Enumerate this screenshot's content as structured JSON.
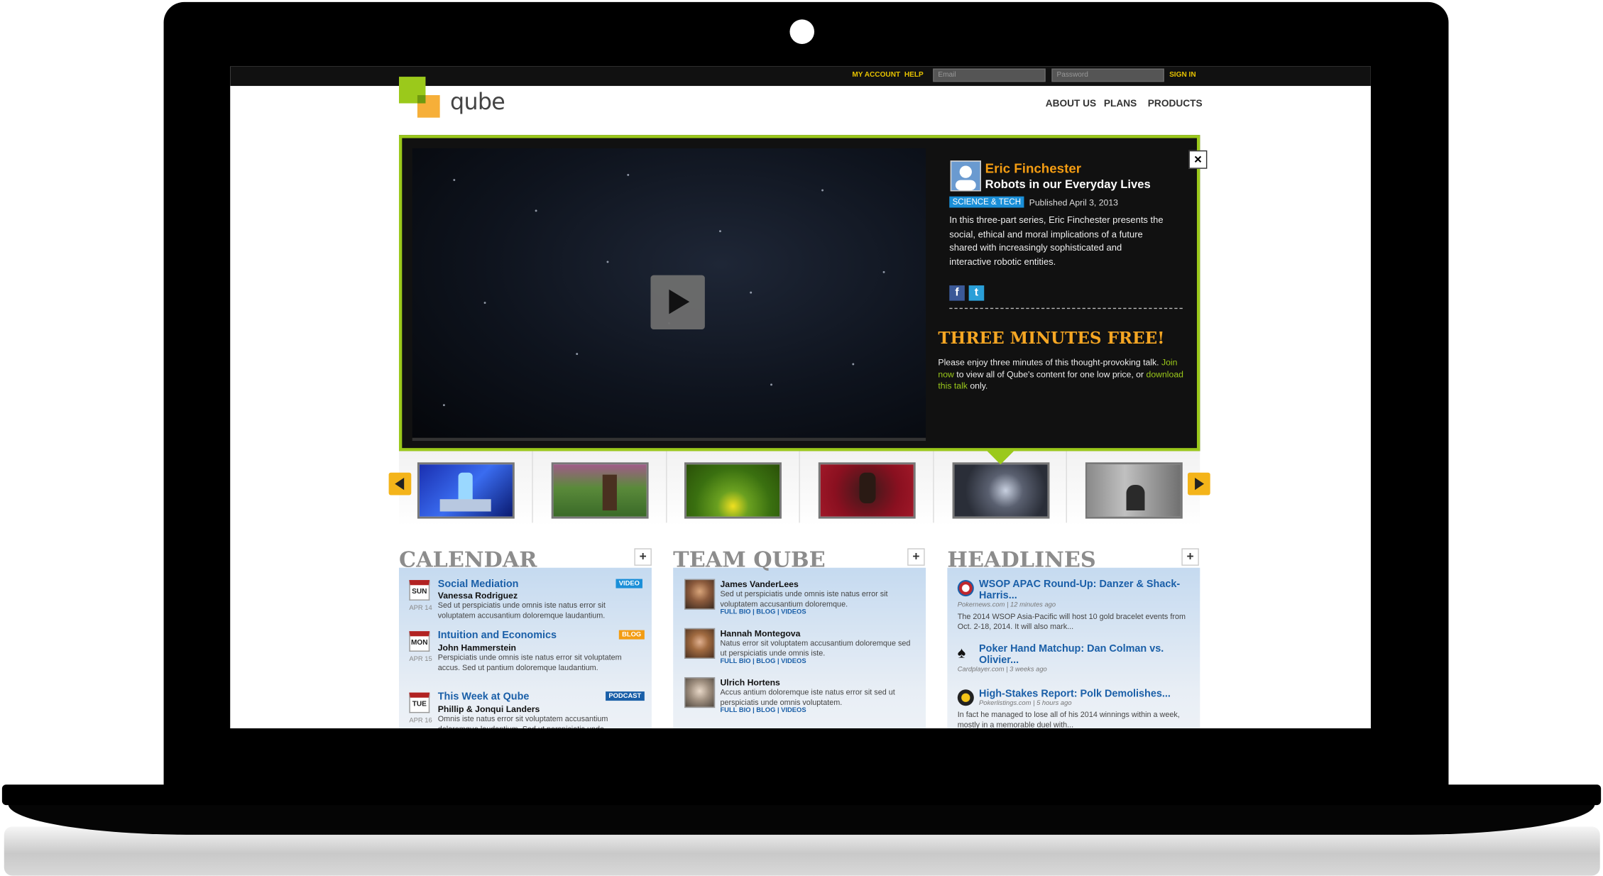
{
  "topbar": {
    "my_account": "MY ACCOUNT",
    "help": "HELP",
    "email_placeholder": "Email",
    "password_placeholder": "Password",
    "sign_in": "SIGN IN"
  },
  "brand": {
    "logo_text": "qube",
    "accent": "#9bc91b",
    "orange": "#f5a623"
  },
  "nav": [
    "ABOUT US",
    "PLANS",
    "PRODUCTS"
  ],
  "hero": {
    "close_label": "×",
    "author": "Eric Finchester",
    "title": "Robots in our Everyday Lives",
    "category": "SCIENCE & TECH",
    "published": "Published April 3, 2013",
    "description": "In this three-part series, Eric Finchester presents the social, ethical and moral implications of a future shared with increasingly sophisticated and interactive robotic entities.",
    "facebook": "f",
    "twitter": "t",
    "promo_title": "THREE MINUTES FREE!",
    "promo_1": "Please enjoy three minutes of this thought-provoking talk.",
    "promo_link_1": "Join now",
    "promo_2": "to view all of Qube's content for one low price, or",
    "promo_link_2": "download this talk",
    "promo_3": "only."
  },
  "calendar": {
    "heading": "CALENDAR",
    "items": [
      {
        "day": "SUN",
        "date": "APR 14",
        "title": "Social Mediation",
        "speaker": "Vanessa Rodriguez",
        "tag": "VIDEO",
        "tag_color": "#1a8fd8",
        "body": "Sed ut perspiciatis unde omnis iste natus error sit voluptatem accusantium doloremque laudantium."
      },
      {
        "day": "MON",
        "date": "APR 15",
        "title": "Intuition and Economics",
        "speaker": "John Hammerstein",
        "tag": "BLOG",
        "tag_color": "#f39c12",
        "body": "Perspiciatis unde omnis iste natus error sit voluptatem accus. Sed ut pantium doloremque laudantium."
      },
      {
        "day": "TUE",
        "date": "APR 16",
        "title": "This Week at Qube",
        "speaker": "Phillip & Jonqui Landers",
        "tag": "PODCAST",
        "tag_color": "#1a5fa8",
        "body": "Omnis iste natus error sit voluptatem accusantium doloremque laudantium. Sed ut perspiciatis unde"
      }
    ]
  },
  "team": {
    "heading": "TEAM QUBE",
    "members": [
      {
        "name": "James VanderLees",
        "bio": "Sed ut perspiciatis unde omnis iste natus error sit voluptatem accusantium doloremque.",
        "links": "FULL BIO | BLOG | VIDEOS"
      },
      {
        "name": "Hannah Montegova",
        "bio": "Natus error sit voluptatem accusantium doloremque sed ut perspiciatis unde omnis iste.",
        "links": "FULL BIO | BLOG | VIDEOS"
      },
      {
        "name": "Ulrich Hortens",
        "bio": "Accus antium doloremque iste natus error sit sed ut perspiciatis unde omnis voluptatem.",
        "links": "FULL BIO | BLOG | VIDEOS"
      }
    ]
  },
  "headlines": {
    "heading": "HEADLINES",
    "items": [
      {
        "title": "WSOP APAC Round-Up: Danzer & Shack-Harris...",
        "source": "Pokernews.com | 12 minutes ago",
        "body": "The 2014 WSOP Asia-Pacific will host 10 gold bracelet events from Oct. 2-18, 2014. It will also mark..."
      },
      {
        "title": "Poker Hand Matchup: Dan Colman vs. Olivier...",
        "source": "Cardplayer.com | 3 weeks ago",
        "body": ""
      },
      {
        "title": "High-Stakes Report: Polk Demolishes...",
        "source": "Pokerlistings.com | 5 hours ago",
        "body": "In fact he managed to lose all of his 2014 winnings within a week, mostly in a memorable duel with..."
      }
    ]
  },
  "plus_label": "+"
}
